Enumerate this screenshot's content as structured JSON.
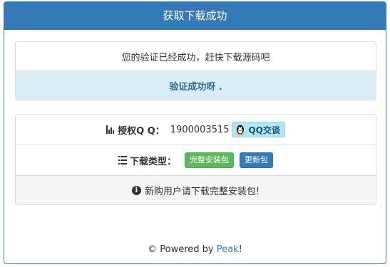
{
  "header": {
    "title": "获取下载成功"
  },
  "message": {
    "text": "您的验证已经成功，赶快下载源码吧"
  },
  "success": {
    "text": "验证成功呀 ."
  },
  "qq": {
    "label": "授权Q Q：",
    "number": "1900003515",
    "button_label": "QQ交谈"
  },
  "download": {
    "label": "下载类型：",
    "full_label": "完整安装包",
    "update_label": "更新包"
  },
  "notice": {
    "text": "新购用户请下载完整安装包!"
  },
  "footer": {
    "prefix": "© Powered by ",
    "link": "Peak",
    "suffix": "!"
  },
  "colors": {
    "primary": "#337ab7",
    "success": "#5cb85c",
    "info_bg": "#d9edf7",
    "info_text": "#31708f"
  },
  "icons": [
    "bar-chart-icon",
    "qq-penguin-icon",
    "list-icon",
    "info-circle-icon"
  ]
}
